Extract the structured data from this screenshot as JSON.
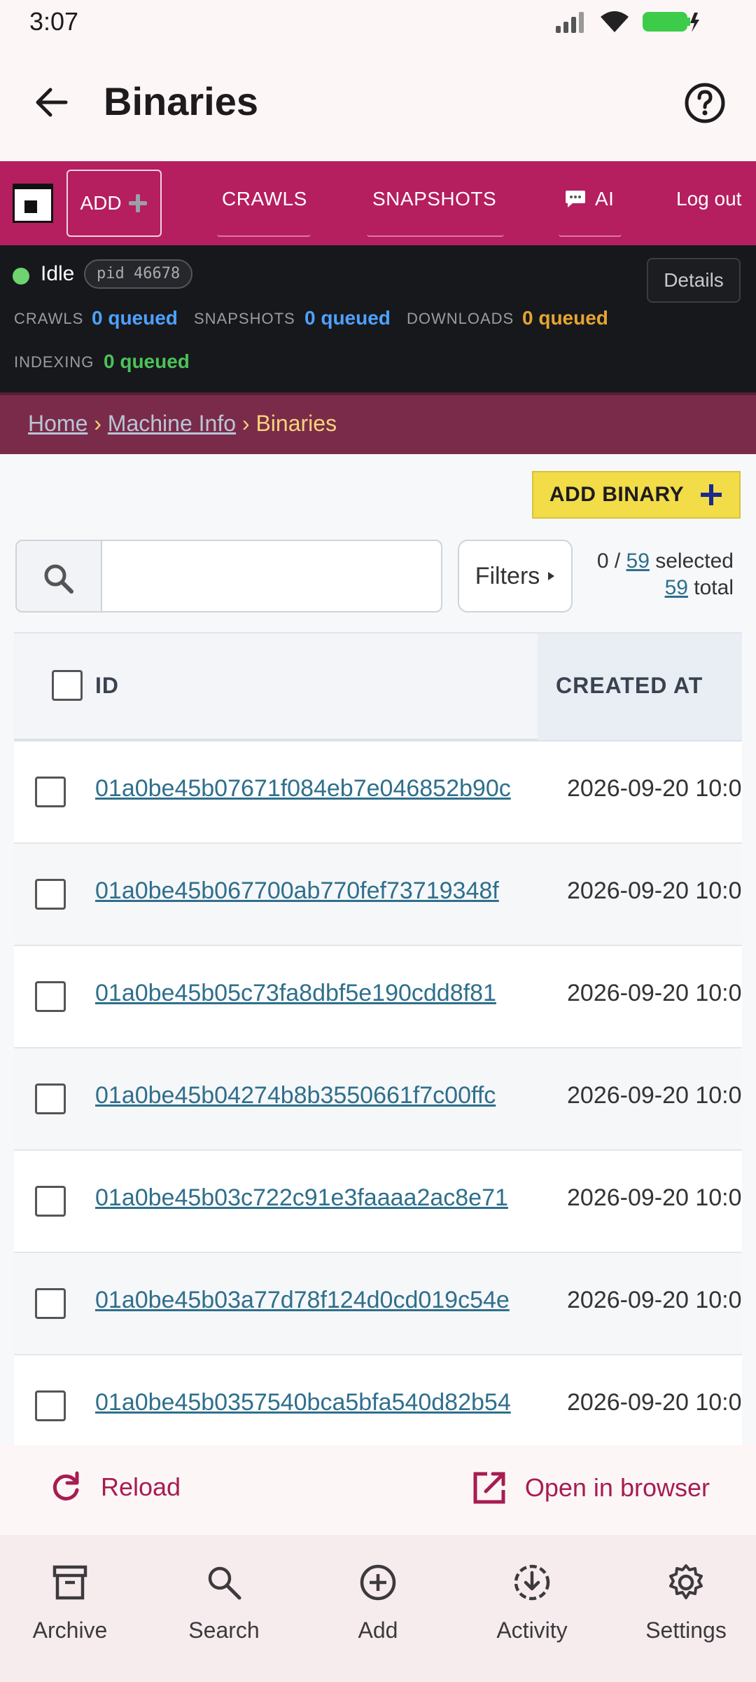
{
  "status_bar": {
    "time": "3:07"
  },
  "app_bar": {
    "title": "Binaries"
  },
  "topnav": {
    "add_label": "ADD",
    "links": [
      "CRAWLS",
      "SNAPSHOTS",
      "AI"
    ],
    "logout": "Log out",
    "brand_color": "#b51e5f"
  },
  "status_panel": {
    "state": "Idle",
    "pid": "pid 46678",
    "details_label": "Details",
    "queues": [
      {
        "label": "CRAWLS",
        "value": "0 queued",
        "color": "#4ea1ff"
      },
      {
        "label": "SNAPSHOTS",
        "value": "0 queued",
        "color": "#4ea1ff"
      },
      {
        "label": "DOWNLOADS",
        "value": "0 queued",
        "color": "#e5a531"
      },
      {
        "label": "INDEXING",
        "value": "0 queued",
        "color": "#4cc25a"
      }
    ]
  },
  "breadcrumb": {
    "home": "Home",
    "machine": "Machine Info",
    "current": "Binaries"
  },
  "toolbar": {
    "add_binary": "ADD BINARY",
    "filters": "Filters",
    "selected_count": "0",
    "selected_total": "59",
    "selected_suffix": "selected",
    "total_count": "59",
    "total_suffix": "total"
  },
  "table": {
    "columns": [
      "ID",
      "CREATED AT"
    ],
    "rows": [
      {
        "id": "01a0be45b07671f084eb7e046852b90c",
        "created": "2026-09-20 10:0"
      },
      {
        "id": "01a0be45b067700ab770fef73719348f",
        "created": "2026-09-20 10:0"
      },
      {
        "id": "01a0be45b05c73fa8dbf5e190cdd8f81",
        "created": "2026-09-20 10:0"
      },
      {
        "id": "01a0be45b04274b8b3550661f7c00ffc",
        "created": "2026-09-20 10:0"
      },
      {
        "id": "01a0be45b03c722c91e3faaaa2ac8e71",
        "created": "2026-09-20 10:0"
      },
      {
        "id": "01a0be45b03a77d78f124d0cd019c54e",
        "created": "2026-09-20 10:0"
      },
      {
        "id": "01a0be45b0357540bca5bfa540d82b54",
        "created": "2026-09-20 10:0"
      }
    ]
  },
  "actions": {
    "reload": "Reload",
    "open_browser": "Open in browser"
  },
  "bottom_nav": [
    "Archive",
    "Search",
    "Add",
    "Activity",
    "Settings"
  ]
}
